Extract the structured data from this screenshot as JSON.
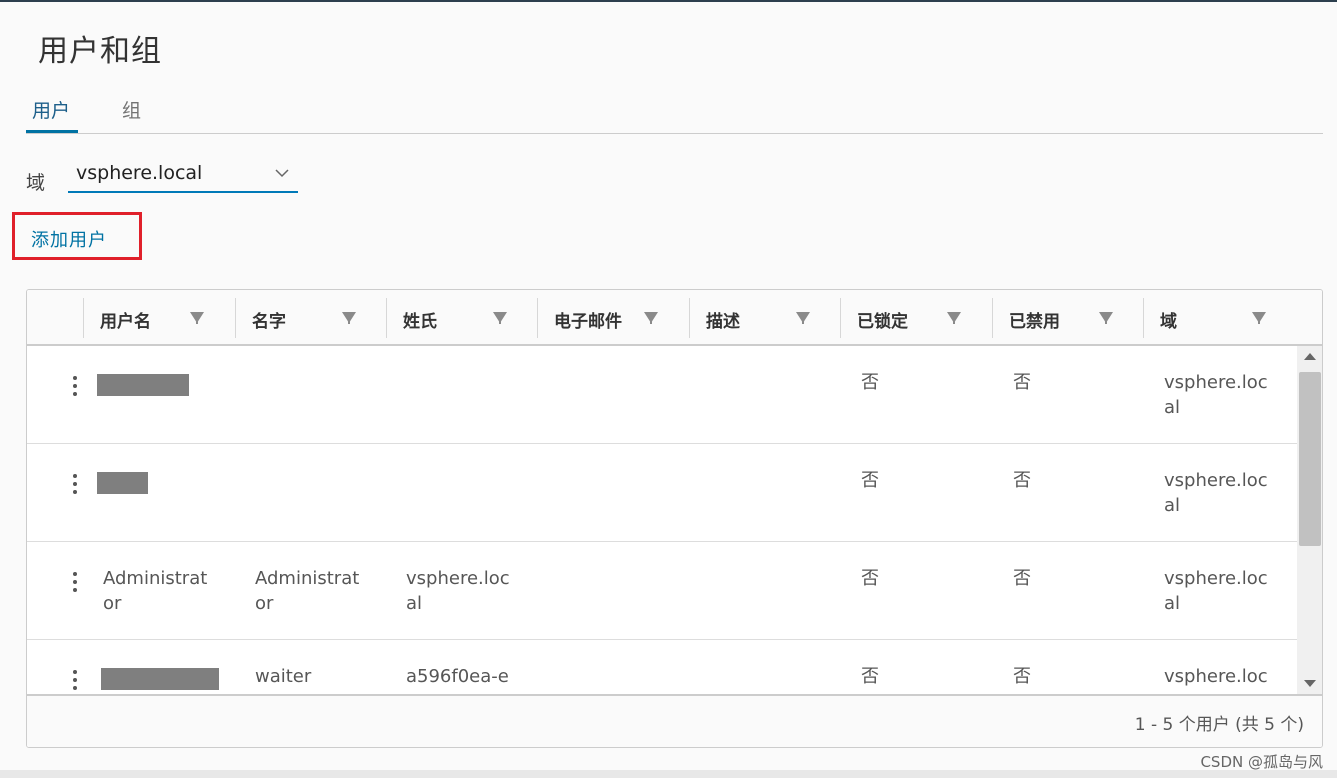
{
  "page": {
    "title": "用户和组"
  },
  "tabs": [
    {
      "label": "用户",
      "active": true
    },
    {
      "label": "组",
      "active": false
    }
  ],
  "domain": {
    "label": "域",
    "selected": "vsphere.local",
    "icon": "chevron-down-icon"
  },
  "actions": {
    "add_user": "添加用户"
  },
  "table": {
    "columns": [
      "用户名",
      "名字",
      "姓氏",
      "电子邮件",
      "描述",
      "已锁定",
      "已禁用",
      "域"
    ],
    "rows": [
      {
        "username": "",
        "username_redacted": true,
        "first_name": "",
        "last_name": "",
        "email": "",
        "description": "",
        "locked": "否",
        "disabled": "否",
        "domain": "vsphere.local"
      },
      {
        "username": "",
        "username_redacted": true,
        "first_name": "",
        "last_name": "",
        "email": "",
        "description": "",
        "locked": "否",
        "disabled": "否",
        "domain": "vsphere.local"
      },
      {
        "username": "Administrator",
        "username_redacted": false,
        "first_name": "Administrator",
        "last_name": "vsphere.local",
        "email": "",
        "description": "",
        "locked": "否",
        "disabled": "否",
        "domain": "vsphere.local"
      },
      {
        "username": "",
        "username_redacted": true,
        "first_name": "waiter",
        "last_name": "a596f0ea-e",
        "email": "",
        "description": "",
        "locked": "否",
        "disabled": "否",
        "domain": "vsphere.loc"
      }
    ],
    "footer": "1 - 5 个用户 (共 5 个)"
  },
  "watermark": "CSDN @孤岛与风",
  "colors": {
    "accent": "#0072a3",
    "highlight_box": "#e0202a",
    "header_bar": "#2d3f4e"
  }
}
